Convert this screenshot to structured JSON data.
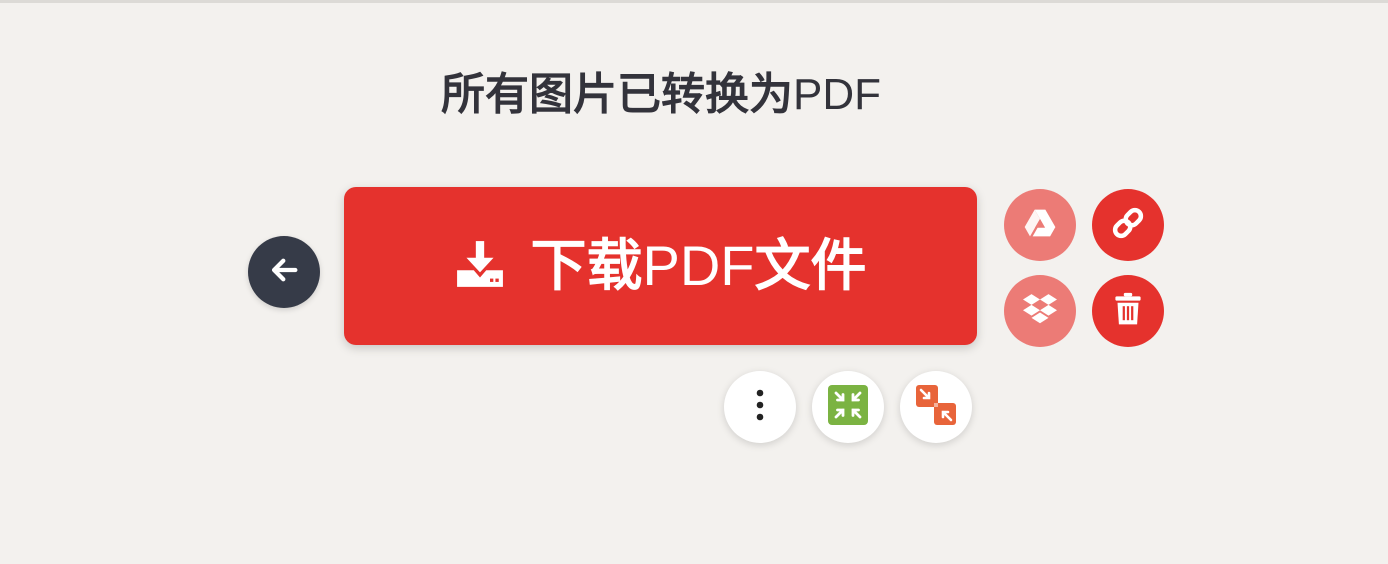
{
  "page": {
    "title_cjk": "所有图片已转换为",
    "title_latin": "PDF"
  },
  "download": {
    "label_cjk_1": "下载",
    "label_latin": "PDF",
    "label_cjk_2": "文件"
  },
  "icons": {
    "back": "arrow-left-icon",
    "download": "download-icon",
    "google_drive": "google-drive-icon",
    "link": "link-icon",
    "dropbox": "dropbox-icon",
    "trash": "trash-icon",
    "more": "more-vertical-icon",
    "compress": "compress-pdf-icon",
    "split": "split-pdf-icon"
  },
  "colors": {
    "brand_red": "#e5322d",
    "light_red": "#ec7b76",
    "dark": "#363b48",
    "compress_green": "#7bb342",
    "split_orange": "#e8643a",
    "background": "#f3f1ee"
  }
}
